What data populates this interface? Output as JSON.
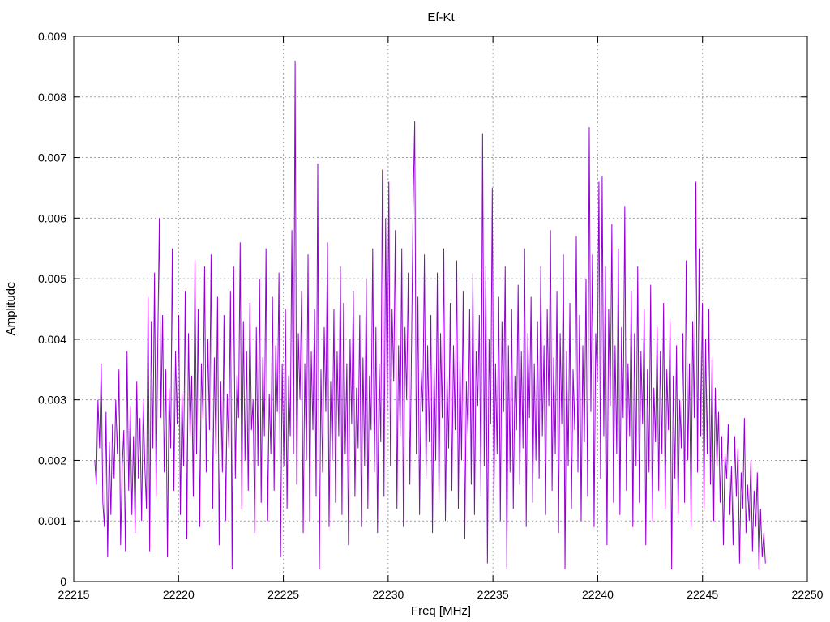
{
  "chart_data": {
    "type": "line",
    "title": "Ef-Kt",
    "xlabel": "Freq [MHz]",
    "ylabel": "Amplitude",
    "xlim": [
      22215,
      22250
    ],
    "ylim": [
      0,
      0.009
    ],
    "xticks": [
      22215,
      22220,
      22225,
      22230,
      22235,
      22240,
      22245,
      22250
    ],
    "yticks": [
      0,
      0.001,
      0.002,
      0.003,
      0.004,
      0.005,
      0.006,
      0.007,
      0.008,
      0.009
    ],
    "ytick_labels": [
      "0",
      "0.001",
      "0.002",
      "0.003",
      "0.004",
      "0.005",
      "0.006",
      "0.007",
      "0.008",
      "0.009"
    ],
    "grid": true,
    "legend": "none",
    "series": [
      {
        "color": "#9400d3",
        "x_start": 22216.0,
        "x_end": 22248.0,
        "values": [
          0.002,
          0.0016,
          0.003,
          0.0022,
          0.0036,
          0.0013,
          0.0009,
          0.0028,
          0.0004,
          0.0023,
          0.0011,
          0.0026,
          0.0017,
          0.003,
          0.0021,
          0.0035,
          0.0006,
          0.0019,
          0.0025,
          0.0005,
          0.0038,
          0.0015,
          0.0029,
          0.0011,
          0.0024,
          0.0008,
          0.0033,
          0.0017,
          0.0027,
          0.001,
          0.003,
          0.0019,
          0.0012,
          0.0047,
          0.0005,
          0.0043,
          0.0022,
          0.0051,
          0.0014,
          0.0039,
          0.006,
          0.0027,
          0.0044,
          0.0018,
          0.0035,
          0.0004,
          0.0032,
          0.0022,
          0.0055,
          0.0015,
          0.0038,
          0.0026,
          0.0044,
          0.0011,
          0.0031,
          0.0019,
          0.0048,
          0.0007,
          0.0041,
          0.0024,
          0.0034,
          0.0014,
          0.0053,
          0.0021,
          0.0045,
          0.0009,
          0.0036,
          0.0027,
          0.0052,
          0.0018,
          0.004,
          0.0025,
          0.0054,
          0.0012,
          0.0037,
          0.0021,
          0.0047,
          0.0006,
          0.0033,
          0.0018,
          0.0044,
          0.001,
          0.0031,
          0.0022,
          0.0048,
          0.0002,
          0.0052,
          0.0017,
          0.0034,
          0.0027,
          0.0056,
          0.0012,
          0.0043,
          0.002,
          0.0038,
          0.0015,
          0.0046,
          0.0025,
          0.003,
          0.0008,
          0.0042,
          0.0019,
          0.005,
          0.0013,
          0.0037,
          0.0024,
          0.0055,
          0.001,
          0.0031,
          0.0021,
          0.0047,
          0.0015,
          0.0039,
          0.0028,
          0.0051,
          0.0004,
          0.0036,
          0.0019,
          0.0045,
          0.0012,
          0.0034,
          0.0024,
          0.0058,
          0.0021,
          0.0086,
          0.0016,
          0.0041,
          0.003,
          0.0048,
          0.0008,
          0.0036,
          0.002,
          0.0054,
          0.001,
          0.0038,
          0.0025,
          0.0045,
          0.0014,
          0.0069,
          0.0002,
          0.0035,
          0.0018,
          0.0042,
          0.0028,
          0.0056,
          0.0009,
          0.0033,
          0.002,
          0.0045,
          0.0013,
          0.0038,
          0.0024,
          0.0052,
          0.0011,
          0.0046,
          0.0021,
          0.0036,
          0.0006,
          0.004,
          0.0026,
          0.0048,
          0.0014,
          0.0032,
          0.0022,
          0.0044,
          0.0009,
          0.0037,
          0.0019,
          0.005,
          0.0012,
          0.0034,
          0.0025,
          0.0055,
          0.0018,
          0.0042,
          0.0008,
          0.0036,
          0.0023,
          0.0068,
          0.0014,
          0.006,
          0.0028,
          0.0066,
          0.0019,
          0.0045,
          0.0033,
          0.0058,
          0.0012,
          0.0039,
          0.0024,
          0.0055,
          0.0009,
          0.0042,
          0.003,
          0.0051,
          0.0016,
          0.0038,
          0.0062,
          0.0076,
          0.0021,
          0.0047,
          0.0011,
          0.0035,
          0.0028,
          0.0054,
          0.0017,
          0.0039,
          0.0023,
          0.0044,
          0.0008,
          0.0036,
          0.002,
          0.0051,
          0.0013,
          0.0041,
          0.0027,
          0.0055,
          0.001,
          0.0034,
          0.0022,
          0.0046,
          0.0015,
          0.0039,
          0.0025,
          0.0053,
          0.0012,
          0.0037,
          0.002,
          0.0048,
          0.0007,
          0.0033,
          0.0024,
          0.0045,
          0.0016,
          0.0051,
          0.0011,
          0.0038,
          0.0029,
          0.0044,
          0.0014,
          0.0074,
          0.0019,
          0.0052,
          0.0003,
          0.004,
          0.0026,
          0.0065,
          0.0013,
          0.0036,
          0.0021,
          0.0047,
          0.001,
          0.0043,
          0.0028,
          0.0052,
          0.0002,
          0.0039,
          0.0018,
          0.0045,
          0.0012,
          0.0034,
          0.0025,
          0.0049,
          0.0016,
          0.0038,
          0.0022,
          0.0055,
          0.0009,
          0.0041,
          0.0027,
          0.0047,
          0.0013,
          0.0036,
          0.002,
          0.0043,
          0.0017,
          0.0052,
          0.0024,
          0.0039,
          0.0011,
          0.0045,
          0.0029,
          0.0058,
          0.0015,
          0.0037,
          0.0021,
          0.0048,
          0.0008,
          0.0041,
          0.0026,
          0.0054,
          0.0002,
          0.0038,
          0.0019,
          0.0046,
          0.0012,
          0.0035,
          0.0025,
          0.0057,
          0.0018,
          0.0044,
          0.001,
          0.0039,
          0.0023,
          0.005,
          0.0014,
          0.0075,
          0.0028,
          0.0054,
          0.0009,
          0.0041,
          0.0033,
          0.0066,
          0.0017,
          0.0067,
          0.0024,
          0.0052,
          0.0006,
          0.0045,
          0.0029,
          0.0059,
          0.0013,
          0.0039,
          0.0021,
          0.0055,
          0.0011,
          0.0042,
          0.0027,
          0.0062,
          0.0015,
          0.0036,
          0.0024,
          0.0048,
          0.0009,
          0.0041,
          0.0019,
          0.0052,
          0.0013,
          0.0038,
          0.0026,
          0.0045,
          0.0006,
          0.0035,
          0.0018,
          0.0049,
          0.001,
          0.0032,
          0.0023,
          0.0042,
          0.0015,
          0.0038,
          0.0021,
          0.0046,
          0.0012,
          0.0035,
          0.0025,
          0.0043,
          0.0002,
          0.0034,
          0.0017,
          0.0039,
          0.0011,
          0.003,
          0.0022,
          0.0041,
          0.0013,
          0.0053,
          0.002,
          0.0036,
          0.0009,
          0.0043,
          0.0027,
          0.0066,
          0.0018,
          0.0055,
          0.0024,
          0.0046,
          0.0012,
          0.004,
          0.0021,
          0.0045,
          0.0016,
          0.0037,
          0.001,
          0.0032,
          0.0019,
          0.0028,
          0.0013,
          0.0024,
          0.0006,
          0.0021,
          0.0017,
          0.0026,
          0.0011,
          0.0019,
          0.0006,
          0.0024,
          0.0014,
          0.0022,
          0.0003,
          0.0018,
          0.0012,
          0.0027,
          0.0008,
          0.0016,
          0.001,
          0.002,
          0.0005,
          0.0015,
          0.0009,
          0.0018,
          0.0002,
          0.0012,
          0.0004,
          0.0008,
          0.0003
        ]
      }
    ]
  }
}
